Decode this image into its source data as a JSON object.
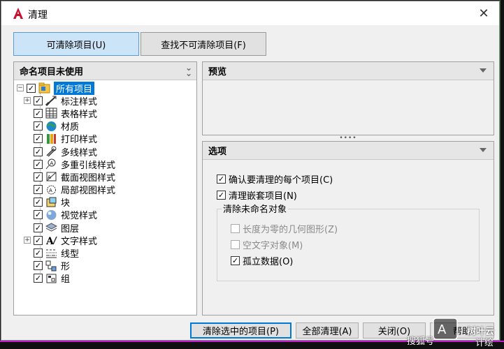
{
  "window": {
    "title": "清理",
    "close_glyph": "✕"
  },
  "tabs": [
    {
      "label": "可清除项目(U)",
      "active": true
    },
    {
      "label": "查找不可清除项目(F)",
      "active": false
    }
  ],
  "left_panel": {
    "title": "命名项目未使用",
    "tree": [
      {
        "label": "所有项目",
        "icon": "all-items-icon",
        "expander": "−",
        "checked": "✓",
        "selected": true
      },
      {
        "label": "标注样式",
        "icon": "dimension-style-icon",
        "expander": "+",
        "checked": "✓"
      },
      {
        "label": "表格样式",
        "icon": "table-style-icon",
        "expander": "",
        "checked": "✓"
      },
      {
        "label": "材质",
        "icon": "material-icon",
        "expander": "",
        "checked": "✓"
      },
      {
        "label": "打印样式",
        "icon": "plot-style-icon",
        "expander": "",
        "checked": "✓"
      },
      {
        "label": "多线样式",
        "icon": "multiline-style-icon",
        "expander": "",
        "checked": "✓"
      },
      {
        "label": "多重引线样式",
        "icon": "multileader-style-icon",
        "expander": "",
        "checked": "✓"
      },
      {
        "label": "截面视图样式",
        "icon": "section-view-style-icon",
        "expander": "",
        "checked": "✓"
      },
      {
        "label": "局部视图样式",
        "icon": "detail-view-style-icon",
        "expander": "",
        "checked": "✓"
      },
      {
        "label": "块",
        "icon": "block-icon",
        "expander": "",
        "checked": "✓"
      },
      {
        "label": "视觉样式",
        "icon": "visual-style-icon",
        "expander": "",
        "checked": "✓"
      },
      {
        "label": "图层",
        "icon": "layer-icon",
        "expander": "",
        "checked": "✓"
      },
      {
        "label": "文字样式",
        "icon": "text-style-icon",
        "expander": "+",
        "checked": "✓"
      },
      {
        "label": "线型",
        "icon": "linetype-icon",
        "expander": "",
        "checked": "✓"
      },
      {
        "label": "形",
        "icon": "shape-icon",
        "expander": "",
        "checked": "✓"
      },
      {
        "label": "组",
        "icon": "group-icon",
        "expander": "",
        "checked": "✓"
      }
    ]
  },
  "preview_panel": {
    "title": "预览"
  },
  "options_panel": {
    "title": "选项",
    "confirm_each": {
      "label": "确认要清理的每个项目(C)",
      "checked": "✓"
    },
    "purge_nested": {
      "label": "清理嵌套项目(N)",
      "checked": "✓"
    },
    "unnamed_group": {
      "label": "清除未命名对象",
      "zero_length": {
        "label": "长度为零的几何图形(Z)",
        "checked": ""
      },
      "empty_text": {
        "label": "空文字对象(M)",
        "checked": ""
      },
      "orphaned_data": {
        "label": "孤立数据(O)",
        "checked": "✓"
      }
    }
  },
  "buttons": {
    "purge_selected": "清除选中的项目(P)",
    "purge_all": "全部清理(A)",
    "close": "关闭(O)",
    "help": "帮助"
  },
  "watermark": {
    "line1": "搜狐号",
    "line2": "树叶云",
    "line3": "计绘"
  },
  "colors": {
    "selection": "#0078d7",
    "active_tab": "#cce4f7",
    "brand_red": "#c8102e"
  }
}
